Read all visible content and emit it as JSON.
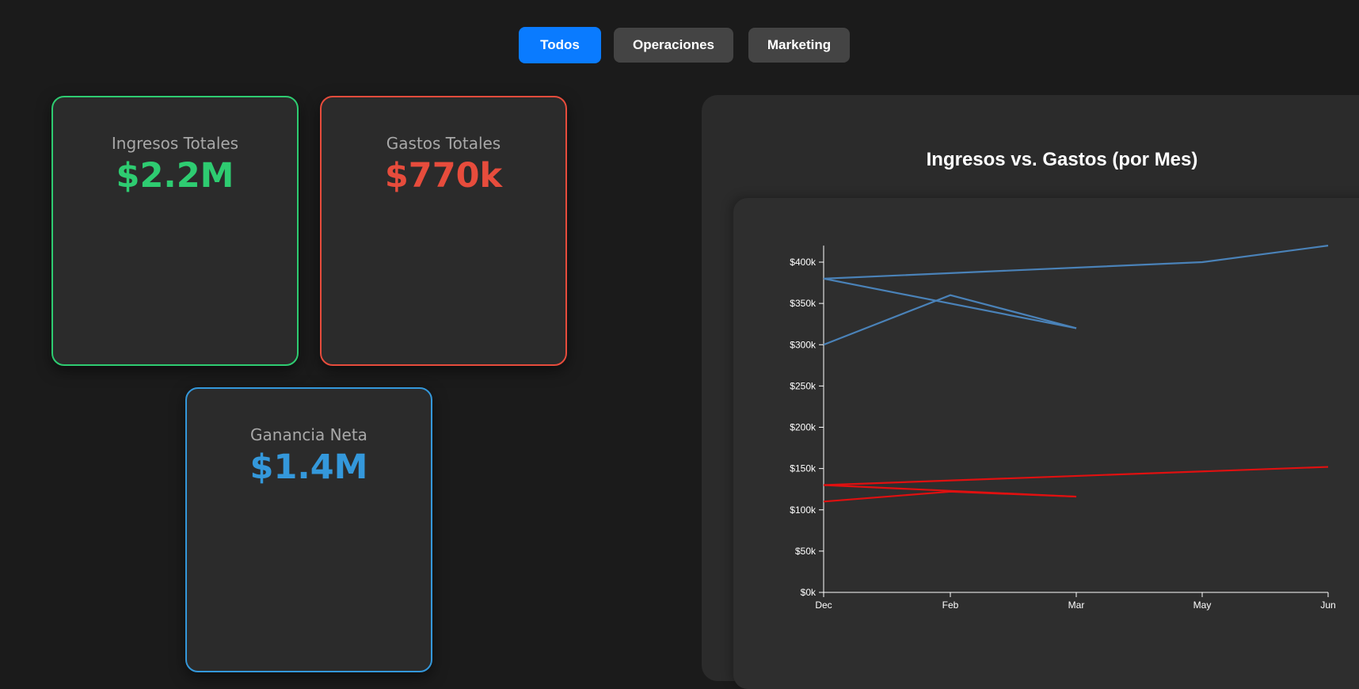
{
  "filters": [
    {
      "label": "Todos",
      "active": true
    },
    {
      "label": "Operaciones",
      "active": false
    },
    {
      "label": "Marketing",
      "active": false
    }
  ],
  "kpis": {
    "ingresos": {
      "label": "Ingresos Totales",
      "value": "$2.2M",
      "color": "#2ecc71"
    },
    "gastos": {
      "label": "Gastos Totales",
      "value": "$770k",
      "color": "#e74c3c"
    },
    "ganancia": {
      "label": "Ganancia Neta",
      "value": "$1.4M",
      "color": "#3498db"
    }
  },
  "chart": {
    "title": "Ingresos vs. Gastos (por Mes)"
  },
  "chart_data": {
    "type": "line",
    "title": "Ingresos vs. Gastos (por Mes)",
    "xlabel": "",
    "ylabel": "",
    "x_ticks": [
      "Dec",
      "Feb",
      "Mar",
      "May",
      "Jun"
    ],
    "y_ticks": [
      "$0k",
      "$50k",
      "$100k",
      "$150k",
      "$200k",
      "$250k",
      "$300k",
      "$350k",
      "$400k"
    ],
    "ylim": [
      0,
      420000
    ],
    "grid": false,
    "legend": "none",
    "series": [
      {
        "color": "#4a82b8",
        "points": [
          [
            "Dec",
            380000
          ],
          [
            "Jun",
            420000
          ]
        ],
        "via": [
          [
            "May",
            400000
          ]
        ]
      },
      {
        "color": "#4a82b8",
        "points": [
          [
            "Dec",
            380000
          ],
          [
            "Mar",
            320000
          ]
        ]
      },
      {
        "color": "#4a82b8",
        "points": [
          [
            "Dec",
            300000
          ],
          [
            "Feb",
            360000
          ],
          [
            "Mar",
            320000
          ]
        ]
      },
      {
        "color": "#e01010",
        "points": [
          [
            "Dec",
            130000
          ],
          [
            "Jun",
            152000
          ]
        ]
      },
      {
        "color": "#e01010",
        "points": [
          [
            "Dec",
            130000
          ],
          [
            "Mar",
            116000
          ]
        ]
      },
      {
        "color": "#e01010",
        "points": [
          [
            "Dec",
            110000
          ],
          [
            "Feb",
            122000
          ],
          [
            "Mar",
            116000
          ]
        ]
      }
    ]
  }
}
